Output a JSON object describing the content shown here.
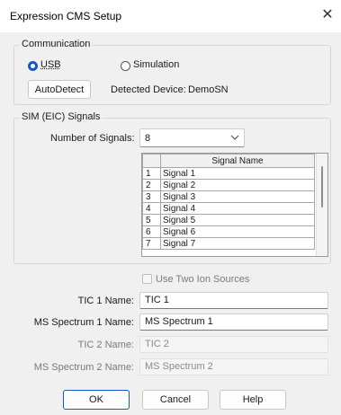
{
  "window": {
    "title": "Expression CMS Setup"
  },
  "communication": {
    "legend": "Communication",
    "usb_label": "USB",
    "simulation_label": "Simulation",
    "selected": "USB",
    "autodetect_label": "AutoDetect",
    "detected_device_label": "Detected Device:",
    "detected_device_value": "DemoSN"
  },
  "sim": {
    "legend": "SIM (EIC) Signals",
    "num_signals_label": "Number of Signals:",
    "num_signals_value": "8",
    "grid_header": "Signal Name",
    "rows": [
      {
        "num": "1",
        "name": "Signal 1"
      },
      {
        "num": "2",
        "name": "Signal 2"
      },
      {
        "num": "3",
        "name": "Signal 3"
      },
      {
        "num": "4",
        "name": "Signal 4"
      },
      {
        "num": "5",
        "name": "Signal 5"
      },
      {
        "num": "6",
        "name": "Signal 6"
      },
      {
        "num": "7",
        "name": "Signal 7"
      }
    ]
  },
  "options": {
    "two_ion_sources_label": "Use Two Ion Sources",
    "two_ion_sources_checked": false
  },
  "fields": {
    "tic1_label": "TIC 1 Name:",
    "tic1_value": "TIC 1",
    "ms1_label": "MS Spectrum 1 Name:",
    "ms1_value": "MS Spectrum 1",
    "tic2_label": "TIC 2 Name:",
    "tic2_value": "TIC 2",
    "ms2_label": "MS Spectrum 2 Name:",
    "ms2_value": "MS Spectrum 2"
  },
  "buttons": {
    "ok_label": "OK",
    "cancel_label": "Cancel",
    "help_label": "Help"
  },
  "colors": {
    "accent": "#1459c9",
    "background": "#f0f0f0"
  },
  "icons": {
    "close": "close-icon",
    "dropdown": "chevron-down-icon"
  }
}
